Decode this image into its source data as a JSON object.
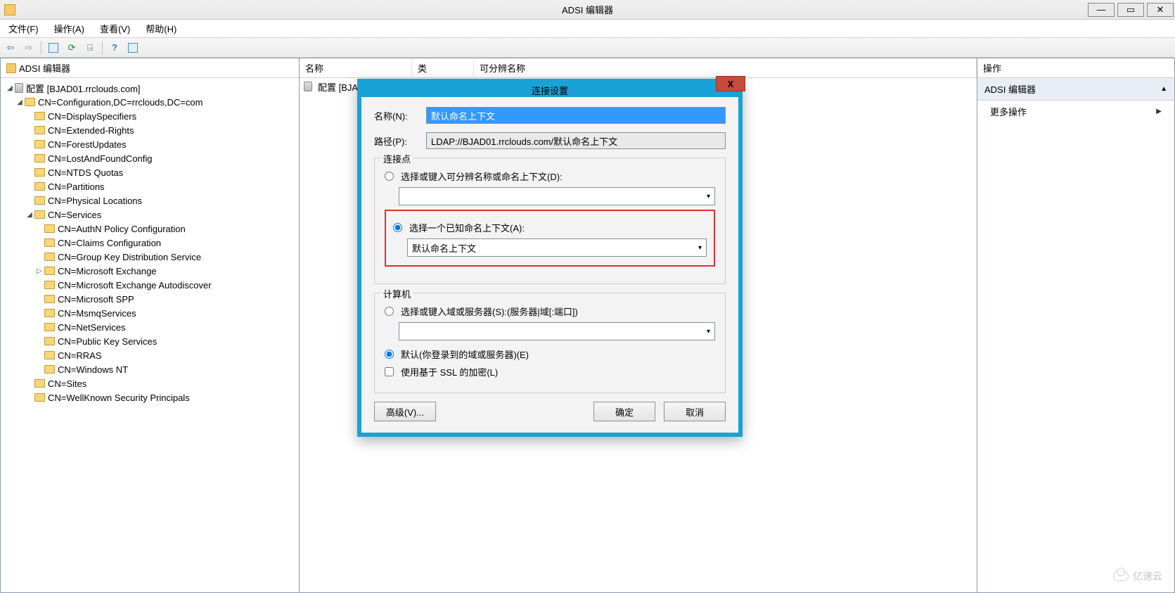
{
  "window": {
    "title": "ADSI 编辑器"
  },
  "menu": {
    "file": "文件(F)",
    "action": "操作(A)",
    "view": "查看(V)",
    "help": "帮助(H)"
  },
  "tree": {
    "root": "ADSI 编辑器",
    "config_node": "配置 [BJAD01.rrclouds.com]",
    "config_child": "CN=Configuration,DC=rrclouds,DC=com",
    "items": [
      "CN=DisplaySpecifiers",
      "CN=Extended-Rights",
      "CN=ForestUpdates",
      "CN=LostAndFoundConfig",
      "CN=NTDS Quotas",
      "CN=Partitions",
      "CN=Physical Locations"
    ],
    "services_label": "CN=Services",
    "services_children": [
      "CN=AuthN Policy Configuration",
      "CN=Claims Configuration",
      "CN=Group Key Distribution Service",
      "CN=Microsoft Exchange",
      "CN=Microsoft Exchange Autodiscover",
      "CN=Microsoft SPP",
      "CN=MsmqServices",
      "CN=NetServices",
      "CN=Public Key Services",
      "CN=RRAS",
      "CN=Windows NT"
    ],
    "tail": [
      "CN=Sites",
      "CN=WellKnown Security Principals"
    ]
  },
  "list": {
    "cols": {
      "name": "名称",
      "class": "类",
      "dn": "可分辨名称"
    },
    "row0": "配置 [BJAD01.rrclou..."
  },
  "actions": {
    "title": "操作",
    "heading": "ADSI 编辑器",
    "more": "更多操作"
  },
  "dialog": {
    "title": "连接设置",
    "name_label": "名称(N):",
    "name_value": "默认命名上下文",
    "path_label": "路径(P):",
    "path_value": "LDAP://BJAD01.rrclouds.com/默认命名上下文",
    "conn_point_legend": "连接点",
    "opt_dn": "选择或键入可分辨名称或命名上下文(D):",
    "opt_known": "选择一个已知命名上下文(A):",
    "known_value": "默认命名上下文",
    "computer_legend": "计算机",
    "opt_server": "选择或键入域或服务器(S):(服务器|域[:端口])",
    "opt_default": "默认(你登录到的域或服务器)(E)",
    "opt_ssl": "使用基于 SSL 的加密(L)",
    "btn_adv": "高级(V)...",
    "btn_ok": "确定",
    "btn_cancel": "取消"
  },
  "watermark": "亿速云"
}
